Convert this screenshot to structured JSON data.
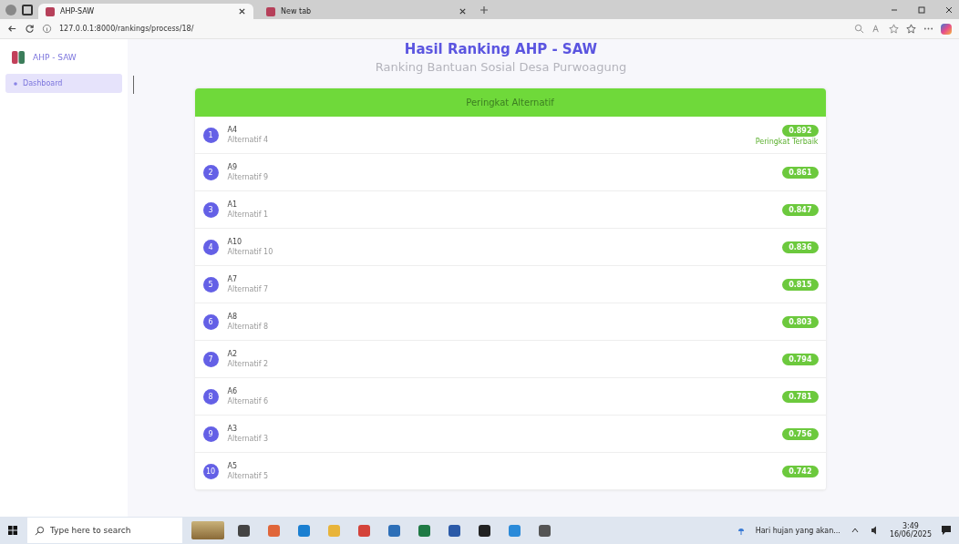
{
  "browser": {
    "tabs": [
      {
        "label": "AHP-SAW",
        "selected": true
      },
      {
        "label": "New tab",
        "selected": false
      }
    ],
    "url": "127.0.0.1:8000/rankings/process/18/"
  },
  "sidebar": {
    "brand": "AHP - SAW",
    "items": [
      {
        "label": "Dashboard",
        "selected": true
      }
    ]
  },
  "page": {
    "title": "Hasil Ranking AHP - SAW",
    "subtitle": "Ranking Bantuan Sosial Desa Purwoagung"
  },
  "ranking": {
    "header": "Peringkat Alternatif",
    "rows": [
      {
        "rank": "1",
        "name": "A4",
        "description": "Alternatif 4",
        "score": "0.892",
        "note": "Peringkat Terbaik"
      },
      {
        "rank": "2",
        "name": "A9",
        "description": "Alternatif 9",
        "score": "0.861"
      },
      {
        "rank": "3",
        "name": "A1",
        "description": "Alternatif 1",
        "score": "0.847"
      },
      {
        "rank": "4",
        "name": "A10",
        "description": "Alternatif 10",
        "score": "0.836"
      },
      {
        "rank": "5",
        "name": "A7",
        "description": "Alternatif 7",
        "score": "0.815"
      },
      {
        "rank": "6",
        "name": "A8",
        "description": "Alternatif 8",
        "score": "0.803"
      },
      {
        "rank": "7",
        "name": "A2",
        "description": "Alternatif 2",
        "score": "0.794"
      },
      {
        "rank": "8",
        "name": "A6",
        "description": "Alternatif 6",
        "score": "0.781"
      },
      {
        "rank": "9",
        "name": "A3",
        "description": "Alternatif 3",
        "score": "0.756"
      },
      {
        "rank": "10",
        "name": "A5",
        "description": "Alternatif 5",
        "score": "0.742"
      }
    ]
  },
  "taskbar": {
    "search_placeholder": "Type here to search",
    "weather": "Hari hujan yang akan...",
    "time": "3:49",
    "date": "16/06/2025"
  }
}
